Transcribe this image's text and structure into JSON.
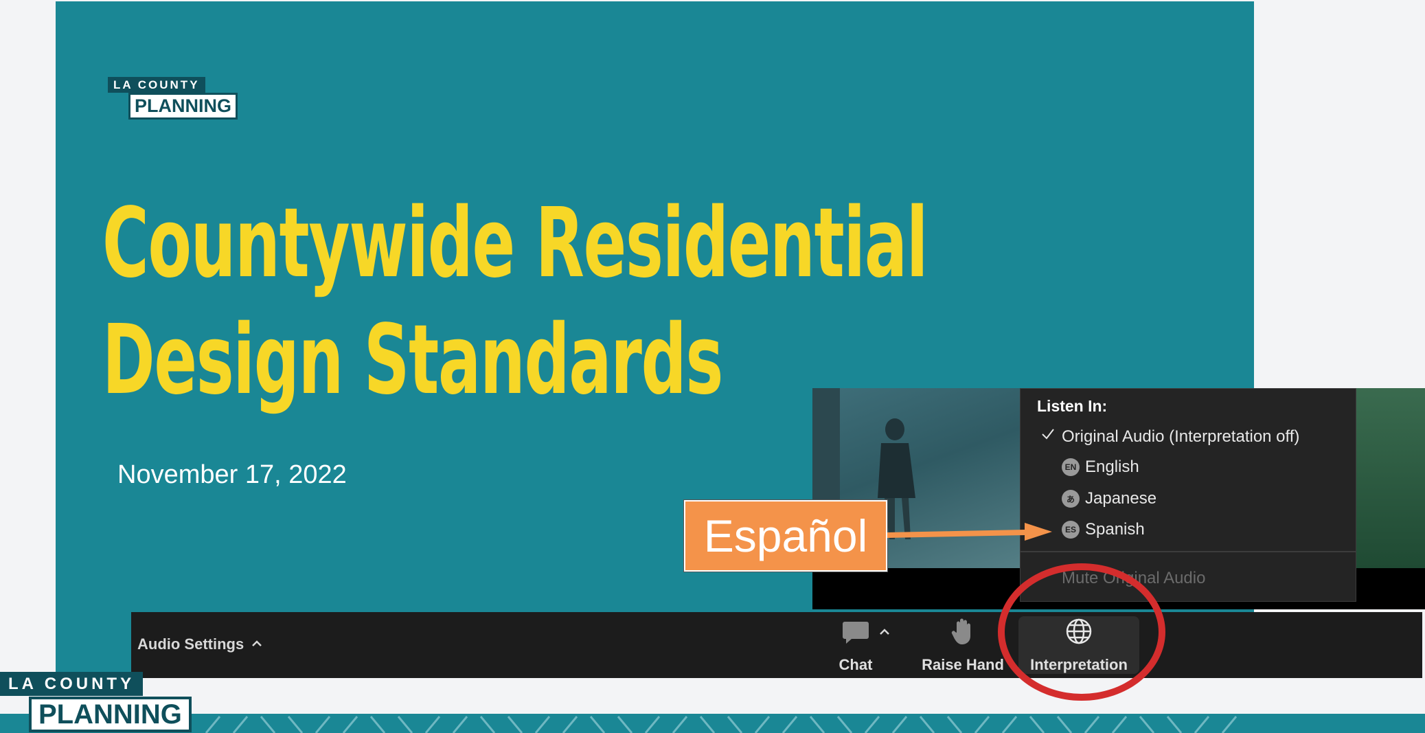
{
  "slide": {
    "logo_top": "LA COUNTY",
    "logo_bottom": "PLANNING",
    "title_line1": "Countywide Residential",
    "title_line2": "Design Standards",
    "date": "November 17, 2022"
  },
  "toolbar": {
    "audio_settings_label": "Audio Settings",
    "chat_label": "Chat",
    "raise_hand_label": "Raise Hand",
    "interpretation_label": "Interpretation"
  },
  "listen_menu": {
    "heading": "Listen In:",
    "options": [
      {
        "label": "Original Audio (Interpretation off)",
        "checked": true
      },
      {
        "badge": "EN",
        "label": "English"
      },
      {
        "badge": "あ",
        "label": "Japanese"
      },
      {
        "badge": "ES",
        "label": "Spanish"
      }
    ],
    "mute_label": "Mute Original Audio"
  },
  "annotation": {
    "callout_text": "Español"
  },
  "footer": {
    "logo_top": "LA COUNTY",
    "logo_bottom": "PLANNING"
  },
  "colors": {
    "slide_bg": "#1a8795",
    "title": "#f7d727",
    "callout": "#f4934a",
    "ring": "#d42d2d"
  }
}
